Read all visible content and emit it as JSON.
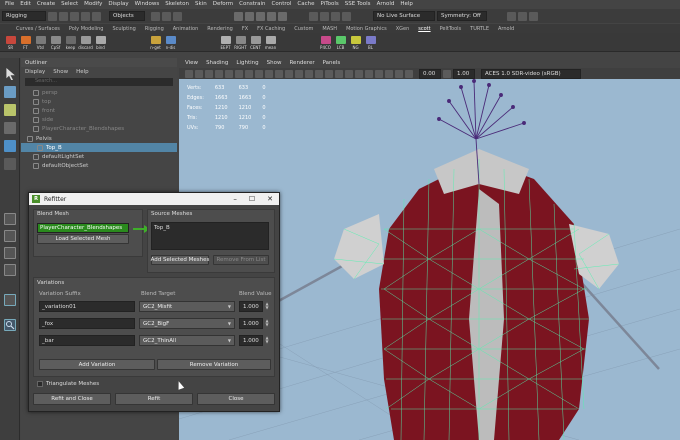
{
  "menubar": [
    "File",
    "Edit",
    "Create",
    "Select",
    "Modify",
    "Display",
    "Windows",
    "Skeleton",
    "Skin",
    "Deform",
    "Constrain",
    "Control",
    "Cache",
    "PiTools",
    "SSE Tools",
    "Arnold",
    "Help"
  ],
  "statusline": {
    "mode": "Rigging",
    "objects": "Objects",
    "live_surface": "No Live Surface",
    "symmetry": "Symmetry: Off"
  },
  "shelf_tabs": [
    "Curves / Surfaces",
    "Poly Modeling",
    "Sculpting",
    "Rigging",
    "Animation",
    "Rendering",
    "FX",
    "FX Caching",
    "Custom",
    "MASH",
    "Motion Graphics",
    "XGen",
    "scott",
    "PeltTools",
    "TURTLE",
    "Arnold"
  ],
  "shelf_buttons": [
    "SR",
    "FT",
    "Vtsl",
    "CpSf",
    "keep",
    "discard",
    "bind",
    "n-get",
    "n-dis",
    "EEPT",
    "RIGHT",
    "CENT",
    "mean",
    "P4CO",
    "LCB",
    "NG",
    "BL"
  ],
  "outliner": {
    "title": "Outliner",
    "menu": [
      "Display",
      "Show",
      "Help"
    ],
    "search_placeholder": "Search...",
    "rows": [
      {
        "label": "persp",
        "dim": true
      },
      {
        "label": "top",
        "dim": true
      },
      {
        "label": "front",
        "dim": true
      },
      {
        "label": "side",
        "dim": true
      },
      {
        "label": "PlayerCharacter_Blendshapes",
        "dim": true
      },
      {
        "label": "Pelvis",
        "dim": false
      },
      {
        "label": "Top_B",
        "dim": false,
        "selected": true
      },
      {
        "label": "defaultLightSet",
        "dim": false
      },
      {
        "label": "defaultObjectSet",
        "dim": false
      }
    ]
  },
  "viewport": {
    "menu": [
      "View",
      "Shading",
      "Lighting",
      "Show",
      "Renderer",
      "Panels"
    ],
    "exposure": "0.00",
    "gamma": "1.00",
    "colorspace": "ACES 1.0 SDR-video (sRGB)",
    "hud": [
      [
        "Verts:",
        "633",
        "633",
        "0"
      ],
      [
        "Edges:",
        "1663",
        "1663",
        "0"
      ],
      [
        "Faces:",
        "1210",
        "1210",
        "0"
      ],
      [
        "Tris:",
        "1210",
        "1210",
        "0"
      ],
      [
        "UVs:",
        "790",
        "790",
        "0"
      ]
    ]
  },
  "dialog": {
    "title": "Refitter",
    "logo": "R",
    "blend_mesh": {
      "label": "Blend Mesh",
      "value": "PlayerCharacter_Blendshapes",
      "load_button": "Load Selected Mesh"
    },
    "source": {
      "label": "Source Meshes",
      "items": [
        "Top_B"
      ],
      "add_button": "Add Selected Meshes",
      "remove_button": "Remove From List"
    },
    "variations": {
      "label": "Variations",
      "col_suffix": "Variation Suffix",
      "col_target": "Blend Target",
      "col_value": "Blend Value",
      "rows": [
        {
          "suffix": "_variation01",
          "target": "GC2_Misfit",
          "value": "1.000"
        },
        {
          "suffix": "_fox",
          "target": "GC2_BigF",
          "value": "1.000"
        },
        {
          "suffix": "_bar",
          "target": "GC2_ThinAll",
          "value": "1.000"
        }
      ],
      "add_button": "Add Variation",
      "remove_button": "Remove Variation"
    },
    "triangulate_label": "Triangulate Meshes",
    "refit_close": "Refit and Close",
    "refit": "Refit",
    "close": "Close"
  },
  "colors": {
    "accent_green": "#2a8a1d",
    "selection": "#5285a6",
    "wire": "#52f2b0",
    "vest": "#8a1620"
  }
}
